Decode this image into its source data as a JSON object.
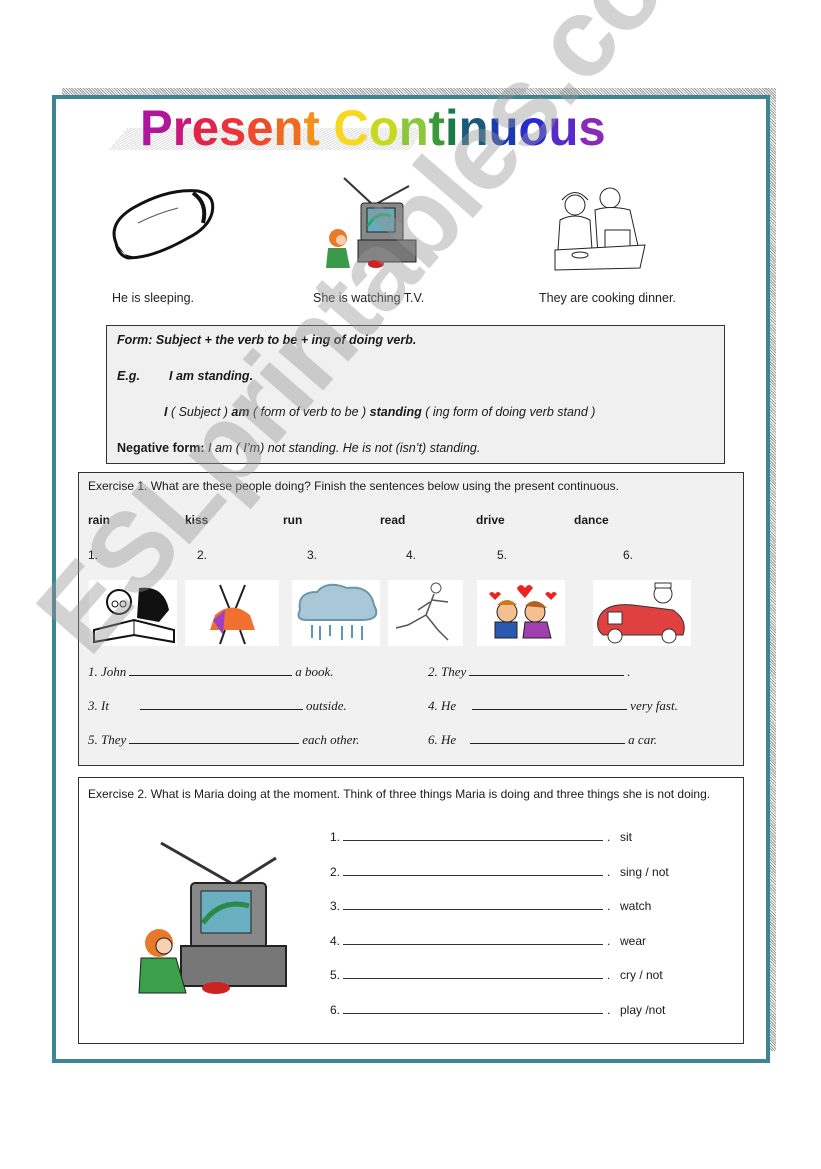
{
  "title": {
    "text": "Present Continuous",
    "letters": [
      {
        "ch": "P",
        "color": "#b0169a"
      },
      {
        "ch": "r",
        "color": "#c8187a"
      },
      {
        "ch": "e",
        "color": "#e0244a"
      },
      {
        "ch": "s",
        "color": "#e8343a"
      },
      {
        "ch": "e",
        "color": "#ee4a2c"
      },
      {
        "ch": "n",
        "color": "#f06a20"
      },
      {
        "ch": "t",
        "color": "#f4901e"
      },
      {
        "ch": " ",
        "color": "#ffffff"
      },
      {
        "ch": "C",
        "color": "#f8d81e"
      },
      {
        "ch": "o",
        "color": "#c8d81e"
      },
      {
        "ch": "n",
        "color": "#8cc63a"
      },
      {
        "ch": "t",
        "color": "#3a9a3a"
      },
      {
        "ch": "i",
        "color": "#1a7a4a"
      },
      {
        "ch": "n",
        "color": "#1a5a7a"
      },
      {
        "ch": "u",
        "color": "#1a3ab0"
      },
      {
        "ch": "o",
        "color": "#2a2ad0"
      },
      {
        "ch": "u",
        "color": "#5a2ac8"
      },
      {
        "ch": "s",
        "color": "#8a2ab8"
      }
    ]
  },
  "examples": [
    {
      "image": "sleeping-bag-icon",
      "caption": "He is sleeping."
    },
    {
      "image": "girl-watching-tv-icon",
      "caption": "She is watching T.V."
    },
    {
      "image": "couple-cooking-icon",
      "caption": "They are cooking dinner."
    }
  ],
  "form_box": {
    "form_line": "Form: Subject + the verb to be + ing of doing verb.",
    "eg_label": "E.g.",
    "eg_text": "I am standing.",
    "breakdown": {
      "w1": "I",
      "w1_note": " ( Subject ) ",
      "w2": "am",
      "w2_note": "  ( form of verb to be ) ",
      "w3": "standing",
      "w3_note": " ( ing form of doing verb stand )"
    },
    "negative_label": "Negative form:",
    "negative_text": " I am ( I’m) not standing. He is not (isn’t) standing."
  },
  "exercise1": {
    "instruction": "Exercise 1. What are these people doing? Finish the sentences below using the present continuous.",
    "verbs": [
      "rain",
      "kiss",
      "run",
      "read",
      "drive",
      "dance"
    ],
    "numbers": [
      "1.",
      "2.",
      "3.",
      "4.",
      "5.",
      "6."
    ],
    "images": [
      "reading-man-icon",
      "dancers-icon",
      "rain-cloud-icon",
      "runner-icon",
      "kissing-kids-icon",
      "man-driving-car-icon"
    ],
    "sentences": [
      {
        "start": "1. John",
        "end": "a book."
      },
      {
        "start": "2. They",
        "end": "."
      },
      {
        "start": "3. It",
        "end": "outside."
      },
      {
        "start": "4. He",
        "end": "very fast."
      },
      {
        "start": "5. They",
        "end": "each other."
      },
      {
        "start": "6. He",
        "end": "a car."
      }
    ]
  },
  "exercise2": {
    "instruction": "Exercise 2. What is Maria doing at the moment. Think of three things Maria is doing and three things she is not doing.",
    "image": "girl-watching-tv-icon",
    "items": [
      {
        "num": "1.",
        "hint": "sit"
      },
      {
        "num": "2.",
        "hint": "sing / not"
      },
      {
        "num": "3.",
        "hint": "watch"
      },
      {
        "num": "4.",
        "hint": "wear"
      },
      {
        "num": "5.",
        "hint": "cry / not"
      },
      {
        "num": "6.",
        "hint": "play /not"
      }
    ]
  },
  "watermark": "ESLprintables.com"
}
